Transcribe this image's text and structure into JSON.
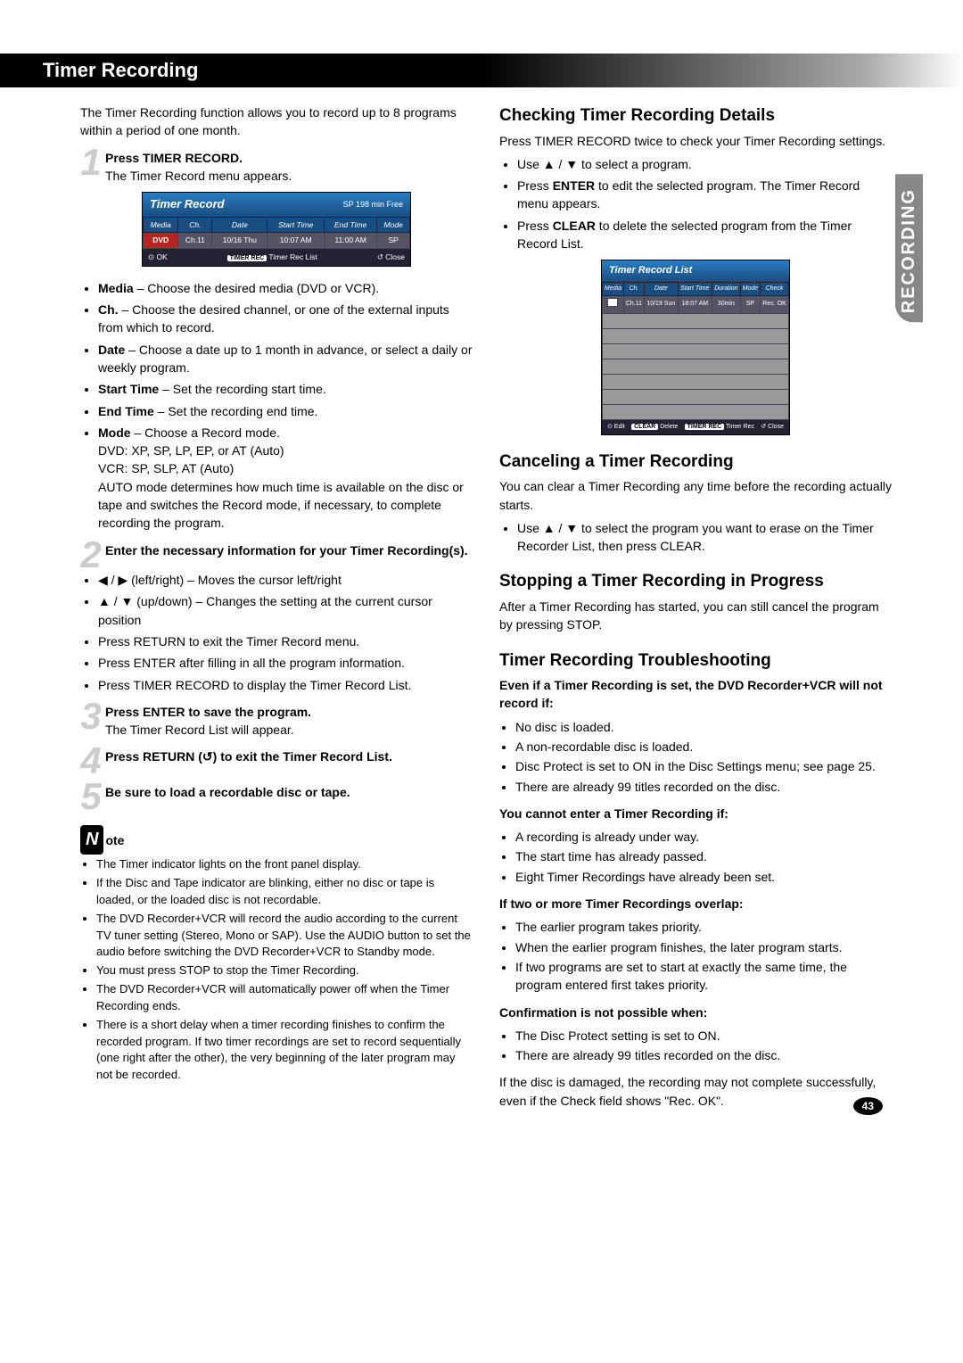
{
  "side_tab": "RECORDING",
  "page_title": "Timer Recording",
  "intro": "The Timer Recording function allows you to record up to 8 programs within a period of one month.",
  "steps": {
    "s1": {
      "bold": "Press TIMER RECORD.",
      "text": "The Timer Record menu appears."
    },
    "s2": {
      "bold": "Enter the necessary information for your Timer Recording(s)."
    },
    "s2_items": {
      "a": "◀ / ▶ (left/right) – Moves the cursor left/right",
      "b": "▲ / ▼ (up/down) – Changes the setting at the current cursor position",
      "c": "Press RETURN to exit the Timer Record menu.",
      "d": "Press ENTER after filling in all the program information.",
      "e": "Press TIMER RECORD to display the Timer Record List."
    },
    "s3": {
      "bold": "Press ENTER to save the program.",
      "text": "The Timer Record List will appear."
    },
    "s4": {
      "bold": "Press RETURN (↺) to exit the Timer Record List."
    },
    "s5": {
      "bold": "Be sure to load a recordable disc or tape."
    }
  },
  "field_desc": {
    "media_b": "Media",
    "media": " – Choose the desired media (DVD or VCR).",
    "ch_b": "Ch.",
    "ch": " – Choose the desired channel, or one of the external inputs from which to record.",
    "date_b": "Date",
    "date": " – Choose a date up to 1 month in advance, or select a daily or weekly program.",
    "st_b": "Start Time",
    "st": " – Set the recording start time.",
    "et_b": "End Time",
    "et": " – Set the recording end time.",
    "mode_b": "Mode",
    "mode": " – Choose a Record mode.",
    "mode_l1": "DVD: XP, SP, LP, EP, or AT (Auto)",
    "mode_l2": "VCR: SP, SLP, AT (Auto)",
    "mode_l3": "AUTO mode determines how much time is available on the disc or tape and switches the Record mode, if necessary, to complete recording the program."
  },
  "osd1": {
    "title": "Timer Record",
    "free": "SP  198  min Free",
    "headers": [
      "Media",
      "Ch.",
      "Date",
      "Start Time",
      "End Time",
      "Mode"
    ],
    "row": {
      "media": "DVD",
      "ch": "Ch.11",
      "date": "10/16 Thu",
      "start": "10:07 AM",
      "end": "11:00 AM",
      "mode": "SP"
    },
    "foot_ok": "⊙ OK",
    "foot_rec": "Timer Rec List",
    "foot_rec_btn": "TIMER REC",
    "foot_close": "↺  Close"
  },
  "note": {
    "head": "ote",
    "items": {
      "a": "The Timer indicator lights on the front panel display.",
      "b": "If the Disc and Tape indicator are blinking, either no disc or tape is loaded, or the loaded disc is not recordable.",
      "c": "The DVD Recorder+VCR will record the audio according to the current TV tuner setting (Stereo, Mono or SAP). Use the AUDIO button to set the audio before switching the DVD Recorder+VCR to Standby mode.",
      "d": "You must press STOP to stop the Timer Recording.",
      "e": "The DVD Recorder+VCR will automatically power off when the Timer Recording ends.",
      "f": "There is a short delay when a timer recording finishes to confirm the recorded program. If two timer recordings are set to record sequentially (one right after the other), the very beginning of the later program may not be recorded."
    }
  },
  "right": {
    "check_h": "Checking Timer Recording Details",
    "check_p": "Press TIMER RECORD twice to check your Timer Recording settings.",
    "check_b1": "Use ▲ / ▼ to select a program.",
    "check_b2a": "Press ",
    "check_b2b": "ENTER",
    "check_b2c": " to edit the selected program. The Timer Record menu appears.",
    "check_b3a": "Press ",
    "check_b3b": "CLEAR",
    "check_b3c": " to delete the selected program from the Timer Record List.",
    "cancel_h": "Canceling a Timer Recording",
    "cancel_p": "You can clear a Timer Recording any time before the recording actually starts.",
    "cancel_b1": "Use ▲ / ▼ to select the program you want to erase on the Timer Recorder List, then press CLEAR.",
    "stop_h": "Stopping a Timer Recording in Progress",
    "stop_p": "After a Timer Recording has started, you can still cancel the program by pressing STOP.",
    "trouble_h": "Timer Recording Troubleshooting",
    "t1_h": "Even if a Timer Recording is set, the DVD Recorder+VCR will not record if:",
    "t1": {
      "a": "No disc is loaded.",
      "b": "A non-recordable disc is loaded.",
      "c": "Disc Protect is set to ON in the Disc Settings menu; see page 25.",
      "d": "There are already 99 titles recorded on the disc."
    },
    "t2_h": "You cannot enter a Timer Recording if:",
    "t2": {
      "a": "A recording is already under way.",
      "b": "The start time has already passed.",
      "c": "Eight Timer Recordings have already been set."
    },
    "t3_h": "If two or more Timer Recordings overlap:",
    "t3": {
      "a": "The earlier program takes priority.",
      "b": "When the earlier program finishes, the later program starts.",
      "c": "If two programs are set to start at exactly the same time, the program entered first takes priority."
    },
    "t4_h": "Confirmation is not possible when:",
    "t4": {
      "a": "The Disc Protect setting is set to ON.",
      "b": "There are already 99 titles recorded on the disc."
    },
    "closing": "If the disc is damaged, the recording may not complete successfully, even if the Check field shows \"Rec. OK\"."
  },
  "osd2": {
    "title": "Timer Record List",
    "headers": [
      "Media",
      "Ch.",
      "Date",
      "Start Time",
      "Duration",
      "Mode",
      "Check"
    ],
    "row": {
      "media": "◧",
      "ch": "Ch.11",
      "date": "10/19 Sun",
      "start": "18:07 AM",
      "dur": "30min",
      "mode": "SP",
      "check": "Rec. OK"
    },
    "foot_edit": "⊙ Edit",
    "foot_delete_btn": "CLEAR",
    "foot_delete": "Delete",
    "foot_rec_btn": "TIMER REC",
    "foot_rec": "Timer Rec",
    "foot_close": "↺  Close"
  },
  "page_num": "43"
}
